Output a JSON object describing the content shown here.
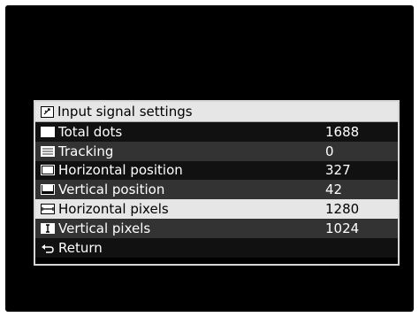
{
  "menu": {
    "title": "Input signal settings",
    "title_icon": "settings-icon",
    "items": [
      {
        "label": "Total dots",
        "value": "1688",
        "icon": "total-dots-icon"
      },
      {
        "label": "Tracking",
        "value": "0",
        "icon": "tracking-icon"
      },
      {
        "label": "Horizontal position",
        "value": "327",
        "icon": "horizontal-position-icon"
      },
      {
        "label": "Vertical position",
        "value": "42",
        "icon": "vertical-position-icon"
      },
      {
        "label": "Horizontal pixels",
        "value": "1280",
        "icon": "horizontal-pixels-icon"
      },
      {
        "label": "Vertical pixels",
        "value": "1024",
        "icon": "vertical-pixels-icon"
      },
      {
        "label": "Return",
        "value": "",
        "icon": "return-icon"
      }
    ],
    "selected_index": 4
  },
  "colors": {
    "screen_bg": "#000000",
    "highlight": "#e6e6e6",
    "row_alt": "#333333",
    "text": "#ffffff"
  }
}
